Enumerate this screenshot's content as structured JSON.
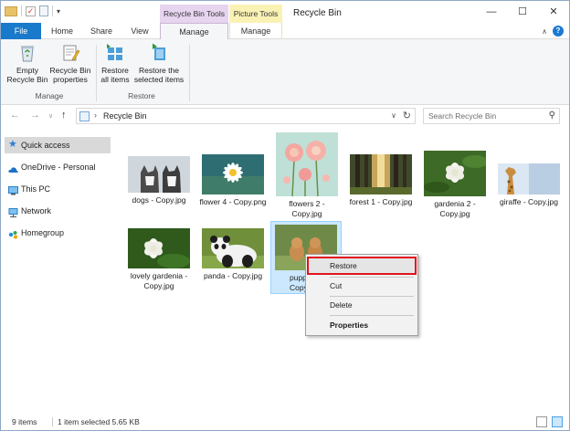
{
  "titlebar": {
    "title": "Recycle Bin",
    "context_tabs": {
      "recycle_bin_tools": "Recycle Bin Tools",
      "picture_tools": "Picture Tools"
    },
    "minimize": "—",
    "maximize": "☐",
    "close": "✕"
  },
  "ribbon": {
    "tabs": {
      "file": "File",
      "home": "Home",
      "share": "Share",
      "view": "View",
      "manage1": "Manage",
      "manage2": "Manage"
    },
    "buttons": {
      "empty_recycle_bin": "Empty Recycle Bin",
      "recycle_bin_properties": "Recycle Bin properties",
      "restore_all_items": "Restore all items",
      "restore_selected_items": "Restore the selected items"
    },
    "groups": {
      "manage": "Manage",
      "restore": "Restore"
    }
  },
  "address": {
    "crumb": "Recycle Bin",
    "search_placeholder": "Search Recycle Bin"
  },
  "nav": {
    "items": [
      {
        "label": "Quick access",
        "icon": "star-icon"
      },
      {
        "label": "OneDrive - Personal",
        "icon": "cloud-icon"
      },
      {
        "label": "This PC",
        "icon": "computer-icon"
      },
      {
        "label": "Network",
        "icon": "network-icon"
      },
      {
        "label": "Homegroup",
        "icon": "homegroup-icon"
      }
    ]
  },
  "files": [
    {
      "name": "dogs - Copy.jpg"
    },
    {
      "name": "flower 4 - Copy.png"
    },
    {
      "name": "flowers 2 - Copy.jpg"
    },
    {
      "name": "forest 1 - Copy.jpg"
    },
    {
      "name": "gardenia 2 - Copy.jpg"
    },
    {
      "name": "giraffe - Copy.jpg"
    },
    {
      "name": "lovely gardenia - Copy.jpg"
    },
    {
      "name": "panda - Copy.jpg"
    },
    {
      "name": "puppies - Copy.jpg"
    }
  ],
  "context_menu": {
    "restore": "Restore",
    "cut": "Cut",
    "delete": "Delete",
    "properties": "Properties"
  },
  "status": {
    "item_count": "9 items",
    "selection": "1 item selected  5.65 KB"
  },
  "colors": {
    "file_tab": "#1979ca",
    "recycle_tools_tab": "#e7d4ef",
    "picture_tools_tab": "#faf2b4",
    "selection": "#cce8ff",
    "highlight_outline": "#e0141e"
  }
}
